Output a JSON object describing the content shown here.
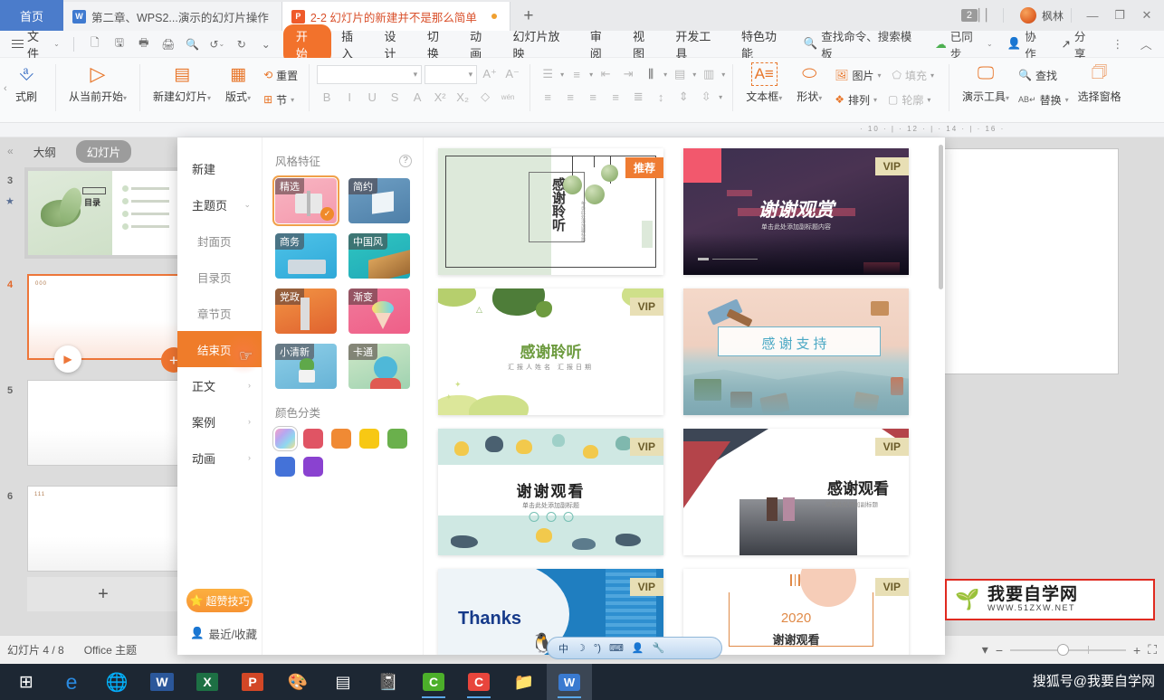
{
  "window": {
    "home_tab": "首页",
    "tabs": [
      {
        "label": "第二章、WPS2...演示的幻灯片操作",
        "icon": "word-doc-icon",
        "type": "w",
        "active": false
      },
      {
        "label": "2-2 幻灯片的新建并不是那么简单",
        "icon": "ppt-doc-icon",
        "type": "p",
        "active": true
      }
    ],
    "new_tab": "+",
    "notification_count": "2",
    "user_name": "枫林",
    "minimize": "—",
    "restore": "❐",
    "close": "✕"
  },
  "menubar": {
    "file": "文件",
    "quick_access": [
      "new-icon",
      "save-icon",
      "print-preview-icon",
      "print-icon",
      "find-icon",
      "undo-icon",
      "redo-icon",
      "customize-icon"
    ],
    "items": [
      {
        "label": "开始",
        "active": true
      },
      {
        "label": "插入",
        "active": false
      },
      {
        "label": "设计",
        "active": false
      },
      {
        "label": "切换",
        "active": false
      },
      {
        "label": "动画",
        "active": false
      },
      {
        "label": "幻灯片放映",
        "active": false
      },
      {
        "label": "审阅",
        "active": false
      },
      {
        "label": "视图",
        "active": false
      },
      {
        "label": "开发工具",
        "active": false
      },
      {
        "label": "特色功能",
        "active": false
      }
    ],
    "search_placeholder": "查找命令、搜索模板",
    "sync": "已同步",
    "collab": "协作",
    "share": "分享",
    "more": "⋮",
    "collapse": "︿"
  },
  "ribbon": {
    "format_painter": "式刷",
    "start_from_current": "从当前开始",
    "new_slide": "新建幻灯片",
    "layout": "版式",
    "section": "节",
    "reset": "重置",
    "font_name": "",
    "font_size": "",
    "bold": "B",
    "italic": "I",
    "underline": "U",
    "strike": "S",
    "font_color": "A",
    "superscript": "X²",
    "subscript": "X₂",
    "clear_format": "clear-format-icon",
    "pinyin": "wén",
    "grow_font": "A⁺",
    "shrink_font": "A⁻",
    "textbox": "文本框",
    "shapes": "形状",
    "picture": "图片",
    "arrange": "排列",
    "fill": "填充",
    "outline": "轮廓",
    "present_tools": "演示工具",
    "find": "查找",
    "replace": "替换",
    "select_pane": "选择窗格"
  },
  "ruler": {
    "ticks": "· 10 · | · 12 · | · 14 · | · 16 ·"
  },
  "left_pane": {
    "collapse": "«",
    "tab_outline": "大纲",
    "tab_slides": "幻灯片",
    "slides": [
      {
        "number": "3",
        "title": "目录",
        "state": "normal",
        "starred": true
      },
      {
        "number": "4",
        "title": "000",
        "state": "selected",
        "starred": false
      },
      {
        "number": "5",
        "title": "",
        "state": "normal",
        "starred": false
      },
      {
        "number": "6",
        "title": "111",
        "state": "normal",
        "starred": false
      }
    ],
    "add_slide": "+"
  },
  "status_bar": {
    "slide_counter": "幻灯片 4 / 8",
    "theme": "Office 主题",
    "zoom_out": "−",
    "zoom_in": "+",
    "fit": "⛶",
    "view_mode": "view-mode-icon"
  },
  "panel": {
    "nav": [
      {
        "label": "新建",
        "type": "top",
        "state": "normal"
      },
      {
        "label": "主题页",
        "type": "top",
        "state": "expanded",
        "arrow": "⌄"
      },
      {
        "label": "封面页",
        "type": "sub",
        "state": "normal"
      },
      {
        "label": "目录页",
        "type": "sub",
        "state": "normal"
      },
      {
        "label": "章节页",
        "type": "sub",
        "state": "normal"
      },
      {
        "label": "结束页",
        "type": "sub",
        "state": "active"
      },
      {
        "label": "正文",
        "type": "top",
        "state": "normal",
        "arrow": "›"
      },
      {
        "label": "案例",
        "type": "top",
        "state": "normal",
        "arrow": "›"
      },
      {
        "label": "动画",
        "type": "top",
        "state": "normal",
        "arrow": "›"
      }
    ],
    "tips_button": "超赞技巧",
    "recent": "最近/收藏",
    "style_header": "风格特征",
    "help_icon": "?",
    "styles": [
      {
        "label": "精选",
        "selected": true
      },
      {
        "label": "简约",
        "selected": false
      },
      {
        "label": "商务",
        "selected": false
      },
      {
        "label": "中国风",
        "selected": false
      },
      {
        "label": "党政",
        "selected": false
      },
      {
        "label": "渐变",
        "selected": false
      },
      {
        "label": "小清新",
        "selected": false
      },
      {
        "label": "卡通",
        "selected": false
      }
    ],
    "color_header": "颜色分类",
    "colors": [
      {
        "name": "multi",
        "hex": "rainbow",
        "selected": true
      },
      {
        "name": "red",
        "hex": "#e05464",
        "selected": false
      },
      {
        "name": "orange",
        "hex": "#f08a34",
        "selected": false
      },
      {
        "name": "yellow",
        "hex": "#f7c814",
        "selected": false
      },
      {
        "name": "green",
        "hex": "#6ab04c",
        "selected": false
      },
      {
        "name": "blue",
        "hex": "#4472d8",
        "selected": false
      },
      {
        "name": "purple",
        "hex": "#8a42d0",
        "selected": false
      }
    ],
    "templates": [
      {
        "title": "感谢聆听",
        "subtitle": "单击此处添加副标题",
        "badge": "推荐",
        "badge_type": "rec",
        "art": "g1"
      },
      {
        "title": "谢谢观赏",
        "subtitle": "单击此处添加副标题内容",
        "badge": "VIP",
        "badge_type": "vip",
        "art": "g2"
      },
      {
        "title": "感谢聆听",
        "subtitle": "汇报人姓名    汇报日期",
        "badge": "VIP",
        "badge_type": "vip",
        "art": "g3"
      },
      {
        "title": "感谢支持",
        "subtitle": "",
        "badge": "",
        "badge_type": "",
        "art": "g4"
      },
      {
        "title": "谢谢观看",
        "subtitle": "单击此处添加副标题",
        "badge": "VIP",
        "badge_type": "vip",
        "art": "g5"
      },
      {
        "title": "感谢观看",
        "subtitle": "单击此处添加副标题",
        "badge": "VIP",
        "badge_type": "vip",
        "art": "g6"
      },
      {
        "title": "Thanks",
        "subtitle": "",
        "badge": "VIP",
        "badge_type": "vip",
        "art": "g7"
      },
      {
        "title": "谢谢观看",
        "subtitle": "2020",
        "badge": "VIP",
        "badge_type": "vip",
        "art": "g8"
      }
    ]
  },
  "ime": {
    "mode": "中",
    "moon": "☽",
    "voice": "°)",
    "keyboard": "⌨",
    "user": "👤",
    "tools": "🔧"
  },
  "watermark": {
    "title": "我要自学网",
    "url": "WWW.51ZXW.NET",
    "sohu": "搜狐号@我要自学网"
  },
  "taskbar": {
    "items": [
      {
        "name": "start-button",
        "glyph": "⊞"
      },
      {
        "name": "edge-icon",
        "glyph": "e"
      },
      {
        "name": "browser-icon",
        "glyph": "🌐"
      },
      {
        "name": "word-icon",
        "glyph": "W"
      },
      {
        "name": "excel-icon",
        "glyph": "X"
      },
      {
        "name": "powerpoint-icon",
        "glyph": "P"
      },
      {
        "name": "paint-icon",
        "glyph": "🎨"
      },
      {
        "name": "calculator-icon",
        "glyph": "▤"
      },
      {
        "name": "notepad-icon",
        "glyph": "📓"
      },
      {
        "name": "camtasia-icon",
        "glyph": "C"
      },
      {
        "name": "camtasia-red-icon",
        "glyph": "C"
      },
      {
        "name": "folder-icon",
        "glyph": "📁"
      },
      {
        "name": "wps-icon",
        "glyph": "W"
      }
    ]
  }
}
